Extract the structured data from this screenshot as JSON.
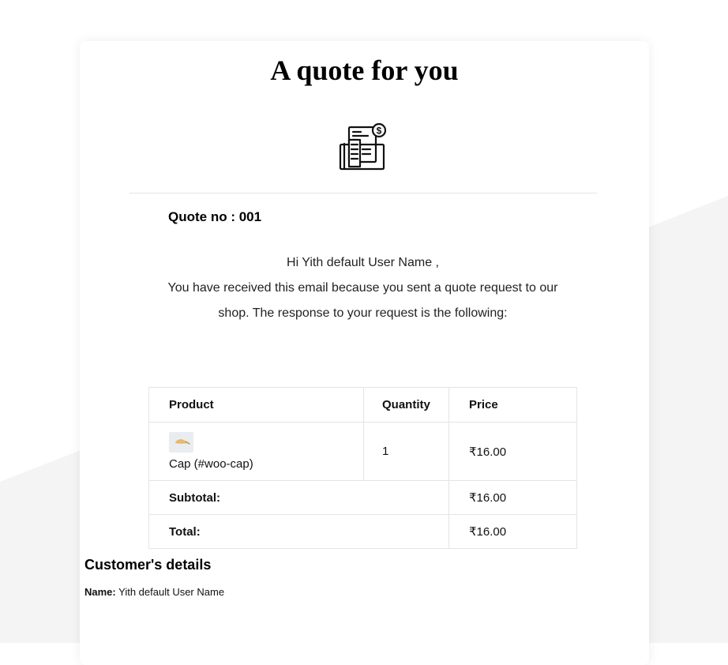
{
  "email": {
    "title": "A quote for you",
    "hero_icon": "invoice-dollar-icon",
    "quote_no": "Quote no : 001",
    "greeting": "Hi Yith default User Name ,",
    "message": "You have received this email because you sent a quote request to our shop. The response to your request is the following:"
  },
  "table": {
    "headers": {
      "product": "Product",
      "quantity": "Quantity",
      "price": "Price"
    },
    "items": [
      {
        "thumbnail_icon": "cap-product-thumbnail",
        "name": "Cap (#woo-cap)",
        "quantity": "1",
        "price": "₹16.00"
      }
    ],
    "subtotal_label": "Subtotal:",
    "subtotal_value": "₹16.00",
    "total_label": "Total:",
    "total_value": "₹16.00"
  },
  "customer": {
    "heading": "Customer's details",
    "name_label": "Name:",
    "name_value": "Yith default User Name"
  },
  "colors": {
    "page_background": "#ffffff",
    "background_shape": "#f4f4f4",
    "card_background": "#ffffff",
    "border": "#e4e4e4",
    "text": "#111111"
  }
}
